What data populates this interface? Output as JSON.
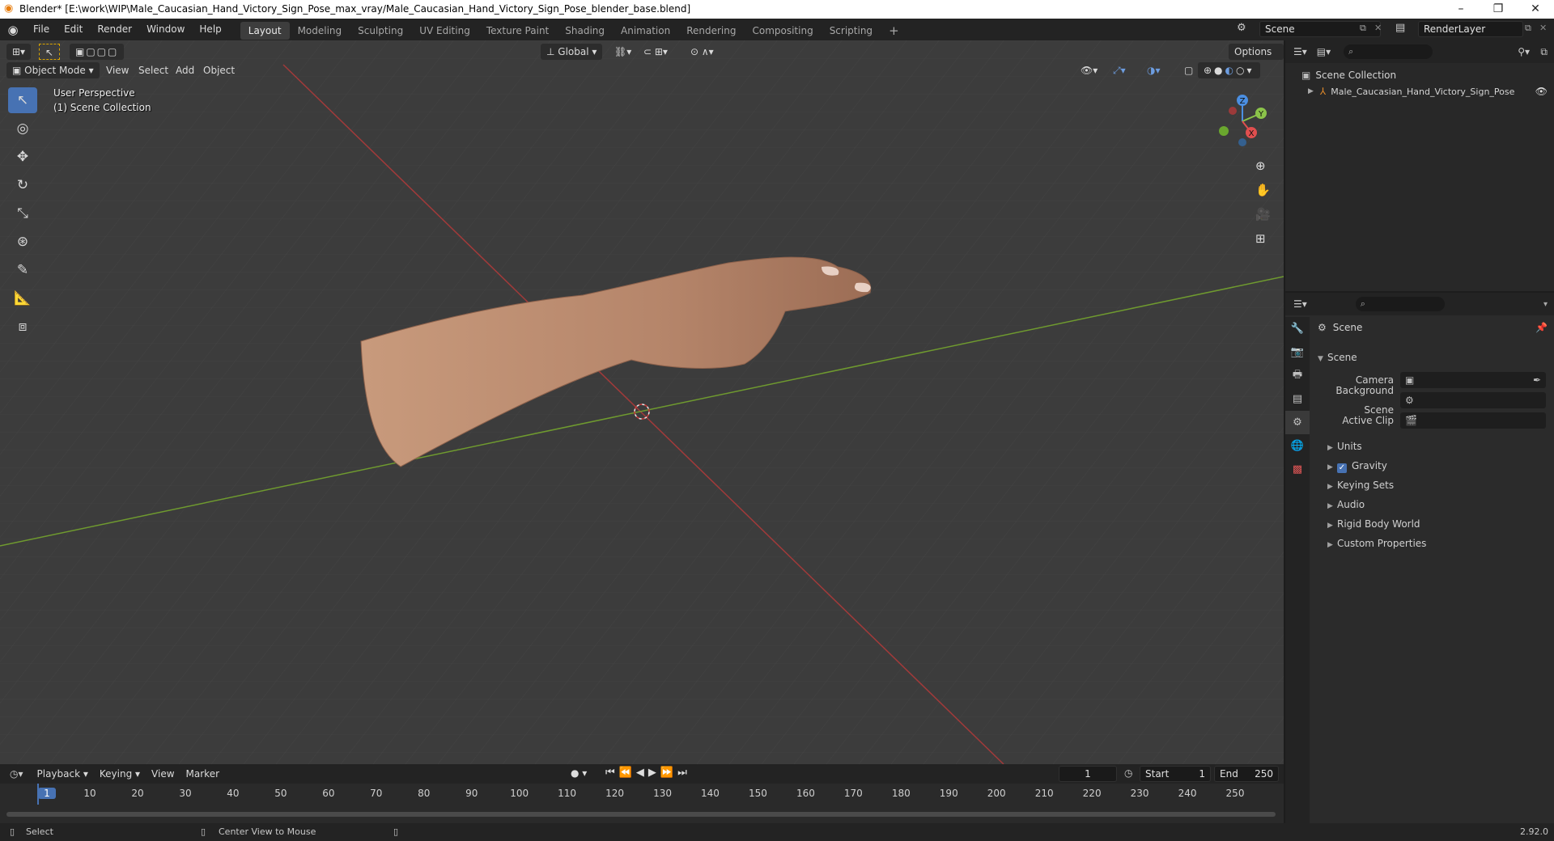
{
  "window": {
    "title": "Blender* [E:\\work\\WIP\\Male_Caucasian_Hand_Victory_Sign_Pose_max_vray/Male_Caucasian_Hand_Victory_Sign_Pose_blender_base.blend]",
    "minimize": "–",
    "maximize": "❐",
    "close": "✕"
  },
  "menu": [
    "File",
    "Edit",
    "Render",
    "Window",
    "Help"
  ],
  "workspaces": [
    {
      "label": "Layout",
      "active": true
    },
    {
      "label": "Modeling"
    },
    {
      "label": "Sculpting"
    },
    {
      "label": "UV Editing"
    },
    {
      "label": "Texture Paint"
    },
    {
      "label": "Shading"
    },
    {
      "label": "Animation"
    },
    {
      "label": "Rendering"
    },
    {
      "label": "Compositing"
    },
    {
      "label": "Scripting"
    }
  ],
  "add_workspace": "+",
  "scene_name": "Scene",
  "view_layer": "RenderLayer",
  "viewport": {
    "transform_orientation": "Global",
    "options_label": "Options",
    "mode": "Object Mode",
    "menus": [
      "View",
      "Select",
      "Add",
      "Object"
    ],
    "perspective_label": "User Perspective",
    "collection_label": "(1) Scene Collection",
    "gizmo": {
      "x": "X",
      "y": "Y",
      "z": "Z"
    }
  },
  "outliner": {
    "root": "Scene Collection",
    "items": [
      {
        "label": "Male_Caucasian_Hand_Victory_Sign_Pose"
      }
    ]
  },
  "properties": {
    "context": "Scene",
    "panel_title": "Scene",
    "fields": [
      {
        "label": "Camera"
      },
      {
        "label": "Background Scene"
      },
      {
        "label": "Active Clip"
      }
    ],
    "subpanels": [
      {
        "label": "Units"
      },
      {
        "label": "Gravity",
        "checked": true
      },
      {
        "label": "Keying Sets"
      },
      {
        "label": "Audio"
      },
      {
        "label": "Rigid Body World"
      },
      {
        "label": "Custom Properties"
      }
    ]
  },
  "timeline": {
    "menus": [
      "Playback",
      "Keying",
      "View",
      "Marker"
    ],
    "current_frame": "1",
    "start_label": "Start",
    "start": "1",
    "end_label": "End",
    "end": "250",
    "ticks": [
      "1",
      "10",
      "20",
      "30",
      "40",
      "50",
      "60",
      "70",
      "80",
      "90",
      "100",
      "110",
      "120",
      "130",
      "140",
      "150",
      "160",
      "170",
      "180",
      "190",
      "200",
      "210",
      "220",
      "230",
      "240",
      "250"
    ]
  },
  "statusbar": {
    "left": "Select",
    "middle": "Center View to Mouse",
    "version": "2.92.0"
  },
  "colors": {
    "accent": "#4772b3",
    "x_axis": "#e04f4f",
    "y_axis": "#8bc34a",
    "z_axis": "#4b8fe2"
  }
}
